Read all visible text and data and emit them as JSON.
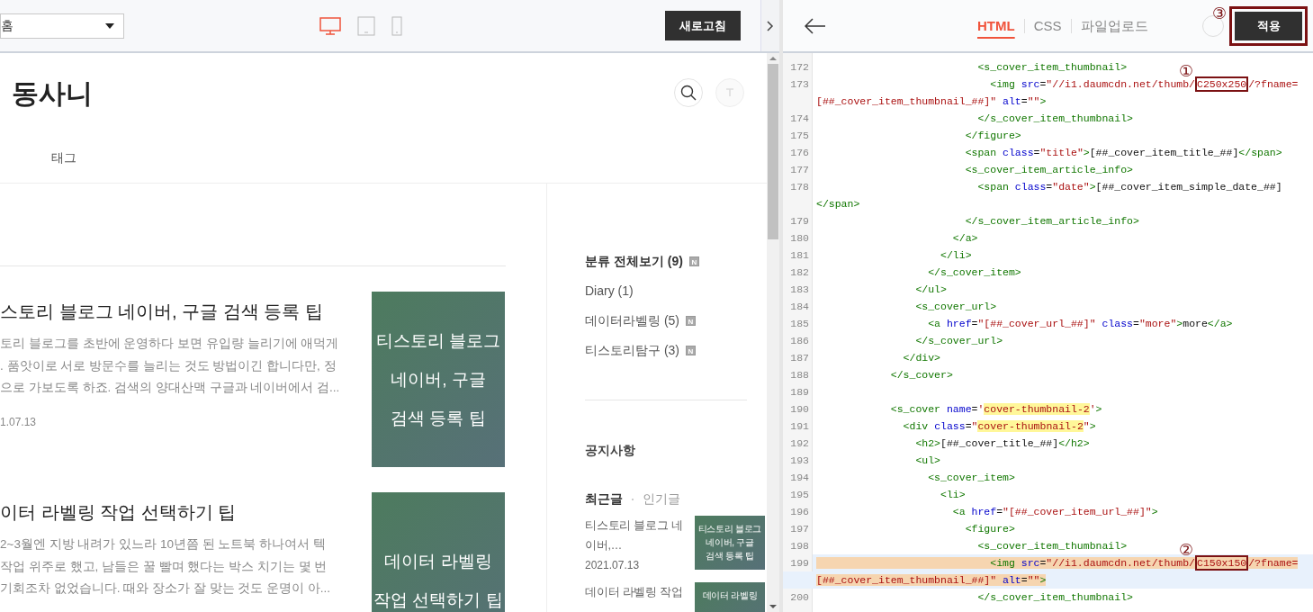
{
  "preview": {
    "toolbar": {
      "page_select": {
        "value": "홈"
      },
      "devices": [
        {
          "kind": "desktop",
          "selected": true
        },
        {
          "kind": "tablet",
          "selected": false
        },
        {
          "kind": "mobile",
          "selected": false
        }
      ],
      "refresh_button": "새로고침"
    },
    "blog": {
      "title": "동사니",
      "nav": [
        "태그"
      ],
      "posts": [
        {
          "title": "스토리 블로그 네이버, 구글 검색 등록 팁",
          "excerpt_lines": [
            "토리 블로그를 초반에 운영하다 보면 유입량 늘리기에 애먹게",
            ". 품앗이로 서로 방문수를 늘리는 것도 방법이긴 합니다만, 정",
            "으로 가보도록 하죠. 검색의 양대산맥 구글과 네이버에서 검..."
          ],
          "date": "1.07.13",
          "thumbnail_lines": [
            "티스토리 블로그",
            "네이버, 구글",
            "검색 등록 팁"
          ]
        },
        {
          "title": "이터 라벨링 작업 선택하기 팁",
          "excerpt_lines": [
            "2~3월엔 지방 내려가 있느라 10년쯤 된 노트북 하나여서 텍",
            "작업 위주로 했고, 남들은 꿀 빨며 했다는 박스 치기는 몇 번",
            "기회조차 없었습니다. 때와 장소가 잘 맞는 것도 운명이 아..."
          ],
          "thumbnail_lines": [
            "데이터 라벨링",
            "작업 선택하기 팁"
          ]
        }
      ],
      "sidebar": {
        "categories": [
          {
            "label": "분류 전체보기 (9)",
            "kind": "all",
            "badge": "N"
          },
          {
            "label": "Diary (1)",
            "kind": "item"
          },
          {
            "label": "데이터라벨링 (5)",
            "kind": "item",
            "badge": "N"
          },
          {
            "label": "티스토리탐구 (3)",
            "kind": "item",
            "badge": "N"
          }
        ],
        "notice": "공지사항",
        "tabs": [
          {
            "label": "최근글",
            "selected": true
          },
          {
            "label": "인기글",
            "selected": false
          }
        ],
        "recent_posts": [
          {
            "title": "티스토리 블로그 네이버,…",
            "date": "2021.07.13",
            "thumbnail_lines": [
              "티스토리 블로그",
              "네이버, 구글",
              "검색 등록 팁"
            ]
          },
          {
            "title": "데이터 라벨링 작업",
            "thumbnail_lines": [
              "데이터 라벨링"
            ]
          }
        ]
      }
    }
  },
  "editor": {
    "tabs": [
      {
        "label": "HTML",
        "selected": true
      },
      {
        "label": "CSS",
        "selected": false
      },
      {
        "label": "파일업로드",
        "selected": false
      }
    ],
    "apply_button": {
      "label": "적용",
      "callout": "③"
    },
    "lines": [
      {
        "number": "172",
        "tokens": [
          {
            "kind": "tag",
            "text": "                          <s_cover_item_thumbnail>"
          }
        ]
      },
      {
        "number": "173",
        "tokens": [
          {
            "kind": "tag",
            "text": "                            <img"
          },
          {
            "kind": "attr",
            "text": " src"
          },
          {
            "kind": "punct",
            "text": "="
          },
          {
            "kind": "str",
            "text": "\"//i1.daumcdn.net/thumb/"
          },
          {
            "kind": "str",
            "text": "C250x250",
            "callout": "①"
          },
          {
            "kind": "str",
            "text": "/?fname="
          },
          {
            "kind": "str",
            "text": "[##_cover_item_thumbnail_##]\"",
            "wrap": true
          },
          {
            "kind": "attr",
            "text": " alt"
          },
          {
            "kind": "punct",
            "text": "="
          },
          {
            "kind": "str",
            "text": "\"\""
          },
          {
            "kind": "tag",
            "text": ">"
          }
        ]
      },
      {
        "number": "174",
        "tokens": [
          {
            "kind": "tag",
            "text": "                          </s_cover_item_thumbnail>"
          }
        ]
      },
      {
        "number": "175",
        "tokens": [
          {
            "kind": "tag",
            "text": "                        </figure>"
          }
        ]
      },
      {
        "number": "176",
        "tokens": [
          {
            "kind": "tag",
            "text": "                        <span"
          },
          {
            "kind": "attr",
            "text": " class"
          },
          {
            "kind": "punct",
            "text": "="
          },
          {
            "kind": "str",
            "text": "\"title\""
          },
          {
            "kind": "tag",
            "text": ">"
          },
          {
            "kind": "text",
            "text": "[##_cover_item_title_##]"
          },
          {
            "kind": "tag",
            "text": "</span>"
          }
        ]
      },
      {
        "number": "177",
        "tokens": [
          {
            "kind": "tag",
            "text": "                        <s_cover_item_article_info>"
          }
        ]
      },
      {
        "number": "178",
        "tokens": [
          {
            "kind": "tag",
            "text": "                          <span"
          },
          {
            "kind": "attr",
            "text": " class"
          },
          {
            "kind": "punct",
            "text": "="
          },
          {
            "kind": "str",
            "text": "\"date\""
          },
          {
            "kind": "tag",
            "text": ">"
          },
          {
            "kind": "text",
            "text": "[##_cover_item_simple_date_##]"
          },
          {
            "kind": "tag",
            "text": "</span>",
            "wrap": true
          }
        ]
      },
      {
        "number": "179",
        "tokens": [
          {
            "kind": "tag",
            "text": "                        </s_cover_item_article_info>"
          }
        ]
      },
      {
        "number": "180",
        "tokens": [
          {
            "kind": "tag",
            "text": "                      </a>"
          }
        ]
      },
      {
        "number": "181",
        "tokens": [
          {
            "kind": "tag",
            "text": "                    </li>"
          }
        ]
      },
      {
        "number": "182",
        "tokens": [
          {
            "kind": "tag",
            "text": "                  </s_cover_item>"
          }
        ]
      },
      {
        "number": "183",
        "tokens": [
          {
            "kind": "tag",
            "text": "                </ul>"
          }
        ]
      },
      {
        "number": "184",
        "tokens": [
          {
            "kind": "tag",
            "text": "                <s_cover_url>"
          }
        ]
      },
      {
        "number": "185",
        "tokens": [
          {
            "kind": "tag",
            "text": "                  <a"
          },
          {
            "kind": "attr",
            "text": " href"
          },
          {
            "kind": "punct",
            "text": "="
          },
          {
            "kind": "str",
            "text": "\"[##_cover_url_##]\""
          },
          {
            "kind": "attr",
            "text": " class"
          },
          {
            "kind": "punct",
            "text": "="
          },
          {
            "kind": "str",
            "text": "\"more\""
          },
          {
            "kind": "tag",
            "text": ">"
          },
          {
            "kind": "text",
            "text": "more"
          },
          {
            "kind": "tag",
            "text": "</a>"
          }
        ]
      },
      {
        "number": "186",
        "tokens": [
          {
            "kind": "tag",
            "text": "                </s_cover_url>"
          }
        ]
      },
      {
        "number": "187",
        "tokens": [
          {
            "kind": "tag",
            "text": "              </div>"
          }
        ]
      },
      {
        "number": "188",
        "tokens": [
          {
            "kind": "tag",
            "text": "            </s_cover>"
          }
        ]
      },
      {
        "number": "189"
      },
      {
        "number": "190",
        "tokens": [
          {
            "kind": "tag",
            "text": "            <s_cover"
          },
          {
            "kind": "attr",
            "text": " name"
          },
          {
            "kind": "punct",
            "text": "="
          },
          {
            "kind": "str",
            "text": "'"
          },
          {
            "kind": "str",
            "text": "cover-thumbnail-2",
            "highlighted": true
          },
          {
            "kind": "str",
            "text": "'"
          },
          {
            "kind": "tag",
            "text": ">"
          }
        ]
      },
      {
        "number": "191",
        "tokens": [
          {
            "kind": "tag",
            "text": "              <div"
          },
          {
            "kind": "attr",
            "text": " class"
          },
          {
            "kind": "punct",
            "text": "="
          },
          {
            "kind": "str",
            "text": "\""
          },
          {
            "kind": "str",
            "text": "cover-thumbnail-2",
            "highlighted": true
          },
          {
            "kind": "str",
            "text": "\""
          },
          {
            "kind": "tag",
            "text": ">"
          }
        ]
      },
      {
        "number": "192",
        "tokens": [
          {
            "kind": "tag",
            "text": "                <h2>"
          },
          {
            "kind": "text",
            "text": "[##_cover_title_##]"
          },
          {
            "kind": "tag",
            "text": "</h2>"
          }
        ]
      },
      {
        "number": "193",
        "tokens": [
          {
            "kind": "tag",
            "text": "                <ul>"
          }
        ]
      },
      {
        "number": "194",
        "tokens": [
          {
            "kind": "tag",
            "text": "                  <s_cover_item>"
          }
        ]
      },
      {
        "number": "195",
        "tokens": [
          {
            "kind": "tag",
            "text": "                    <li>"
          }
        ]
      },
      {
        "number": "196",
        "tokens": [
          {
            "kind": "tag",
            "text": "                      <a"
          },
          {
            "kind": "attr",
            "text": " href"
          },
          {
            "kind": "punct",
            "text": "="
          },
          {
            "kind": "str",
            "text": "\"[##_cover_item_url_##]\""
          },
          {
            "kind": "tag",
            "text": ">"
          }
        ]
      },
      {
        "number": "197",
        "tokens": [
          {
            "kind": "tag",
            "text": "                        <figure>"
          }
        ]
      },
      {
        "number": "198",
        "tokens": [
          {
            "kind": "tag",
            "text": "                          <s_cover_item_thumbnail>"
          }
        ]
      },
      {
        "number": "199",
        "current": true,
        "selected": true,
        "tokens": [
          {
            "kind": "tag",
            "text": "                            <img"
          },
          {
            "kind": "attr",
            "text": " src"
          },
          {
            "kind": "punct",
            "text": "="
          },
          {
            "kind": "str",
            "text": "\"//i1.daumcdn.net/thumb/"
          },
          {
            "kind": "str",
            "text": "C150x150",
            "callout": "②"
          },
          {
            "kind": "str",
            "text": "/?fname="
          },
          {
            "kind": "str",
            "text": "[##_cover_item_thumbnail_##]\"",
            "wrap": true
          },
          {
            "kind": "attr",
            "text": " alt"
          },
          {
            "kind": "punct",
            "text": "="
          },
          {
            "kind": "str",
            "text": "\"\""
          },
          {
            "kind": "tag",
            "text": ">"
          }
        ]
      },
      {
        "number": "200",
        "tokens": [
          {
            "kind": "tag",
            "text": "                          </s_cover_item_thumbnail>"
          }
        ]
      }
    ]
  }
}
